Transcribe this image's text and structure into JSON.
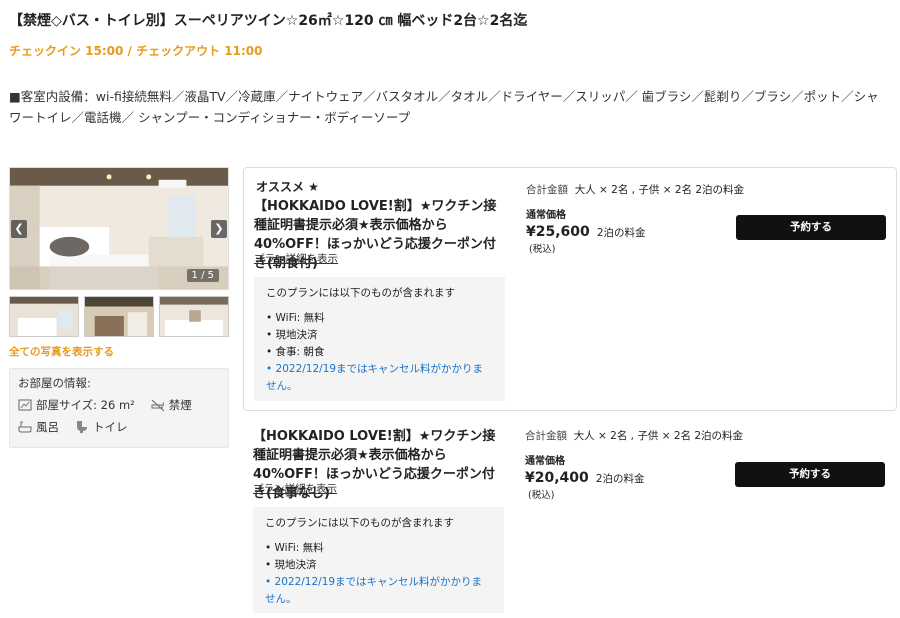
{
  "room": {
    "title": "【禁煙◇バス・トイレ別】スーペリアツイン☆26㎡☆120 ㎝ 幅ベッド2台☆2名迄",
    "checkin_checkout": "チェックイン 15:00 / チェックアウト 11:00",
    "amenities": "■客室内設備：wi-fi接続無料／液晶TV／冷蔵庫／ナイトウェア／バスタオル／タオル／ドライヤー／スリッパ／ 歯ブラシ／髭剃り／ブラシ／ポット／シャワートイレ／電話機／ シャンプー・コンディショナー・ボディーソープ"
  },
  "gallery": {
    "counter": "1 / 5",
    "prev_icon": "chevron-left-icon",
    "next_icon": "chevron-right-icon",
    "all_photos_label": "全ての写真を表示する"
  },
  "room_info": {
    "header": "お部屋の情報:",
    "size_label": "部屋サイズ: 26 m²",
    "non_smoking_label": "禁煙",
    "bath_label": "風呂",
    "toilet_label": "トイレ"
  },
  "plans": [
    {
      "badge": "オススメ ★",
      "name": "【HOKKAIDO LOVE!割】★ワクチン接種証明書提示必須★表示価格から40%OFF！ほっかいどう応援クーポン付き(朝食付)",
      "detail_link": "プラン詳細を表示",
      "includes_title": "このプランには以下のものが含まれます",
      "includes": [
        "WiFi: 無料",
        "現地決済",
        "食事: 朝食"
      ],
      "cancel_note": "2022/12/19まではキャンセル料がかかりません。",
      "total_label": "合計金額",
      "guests": "大人 × 2名 , 子供 × 2名 2泊の料金",
      "normal_price_label": "通常価格",
      "price": "¥25,600",
      "price_suffix": "2泊の料金",
      "tax_note": "(税込)",
      "reserve_label": "予約する"
    },
    {
      "badge": "",
      "name": "【HOKKAIDO LOVE!割】★ワクチン接種証明書提示必須★表示価格から40%OFF！ほっかいどう応援クーポン付き(食事なし)",
      "detail_link": "プラン詳細を表示",
      "includes_title": "このプランには以下のものが含まれます",
      "includes": [
        "WiFi: 無料",
        "現地決済"
      ],
      "cancel_note": "2022/12/19まではキャンセル料がかかりません。",
      "total_label": "合計金額",
      "guests": "大人 × 2名 , 子供 × 2名 2泊の料金",
      "normal_price_label": "通常価格",
      "price": "¥20,400",
      "price_suffix": "2泊の料金",
      "tax_note": "(税込)",
      "reserve_label": "予約する"
    }
  ],
  "colors": {
    "accent": "#e89a1c",
    "link_blue": "#1a73c9",
    "button": "#111111",
    "panel": "#f4f4f4"
  }
}
